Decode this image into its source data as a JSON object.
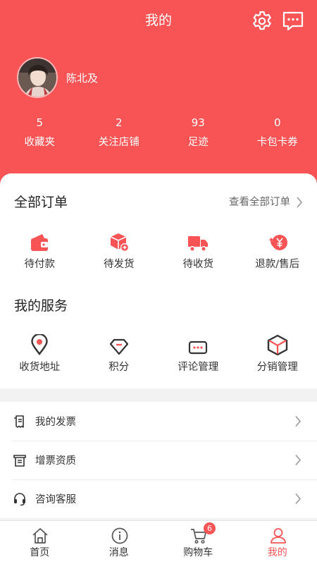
{
  "header": {
    "title": "我的",
    "settings_icon": "gear-icon",
    "message_icon": "chat-bubble-icon",
    "background_color": "#f85456"
  },
  "profile": {
    "name": "陈北及",
    "avatar_icon": "user-avatar-photo"
  },
  "stats": [
    {
      "value": "5",
      "label": "收藏夹"
    },
    {
      "value": "2",
      "label": "关注店铺"
    },
    {
      "value": "93",
      "label": "足迹"
    },
    {
      "value": "0",
      "label": "卡包卡券"
    }
  ],
  "orders": {
    "title": "全部订单",
    "view_all": "查看全部订单",
    "items": [
      {
        "label": "待付款",
        "icon": "wallet-icon"
      },
      {
        "label": "待发货",
        "icon": "package-icon"
      },
      {
        "label": "待收货",
        "icon": "truck-icon"
      },
      {
        "label": "退款/售后",
        "icon": "refund-yen-icon"
      }
    ]
  },
  "services": {
    "title": "我的服务",
    "items": [
      {
        "label": "收货地址",
        "icon": "location-pin-icon"
      },
      {
        "label": "积分",
        "icon": "diamond-icon"
      },
      {
        "label": "评论管理",
        "icon": "comment-icon"
      },
      {
        "label": "分销管理",
        "icon": "cube-icon"
      }
    ]
  },
  "list": [
    {
      "label": "我的发票",
      "icon": "invoice-icon"
    },
    {
      "label": "增票资质",
      "icon": "receipt-icon"
    },
    {
      "label": "咨询客服",
      "icon": "headset-icon"
    }
  ],
  "tabbar": {
    "items": [
      {
        "label": "首页",
        "icon": "home-icon"
      },
      {
        "label": "消息",
        "icon": "info-icon"
      },
      {
        "label": "购物车",
        "icon": "cart-icon",
        "badge": "6"
      },
      {
        "label": "我的",
        "icon": "person-icon",
        "active": true
      }
    ]
  },
  "colors": {
    "accent": "#f85456",
    "background": "#f2f2f2"
  }
}
